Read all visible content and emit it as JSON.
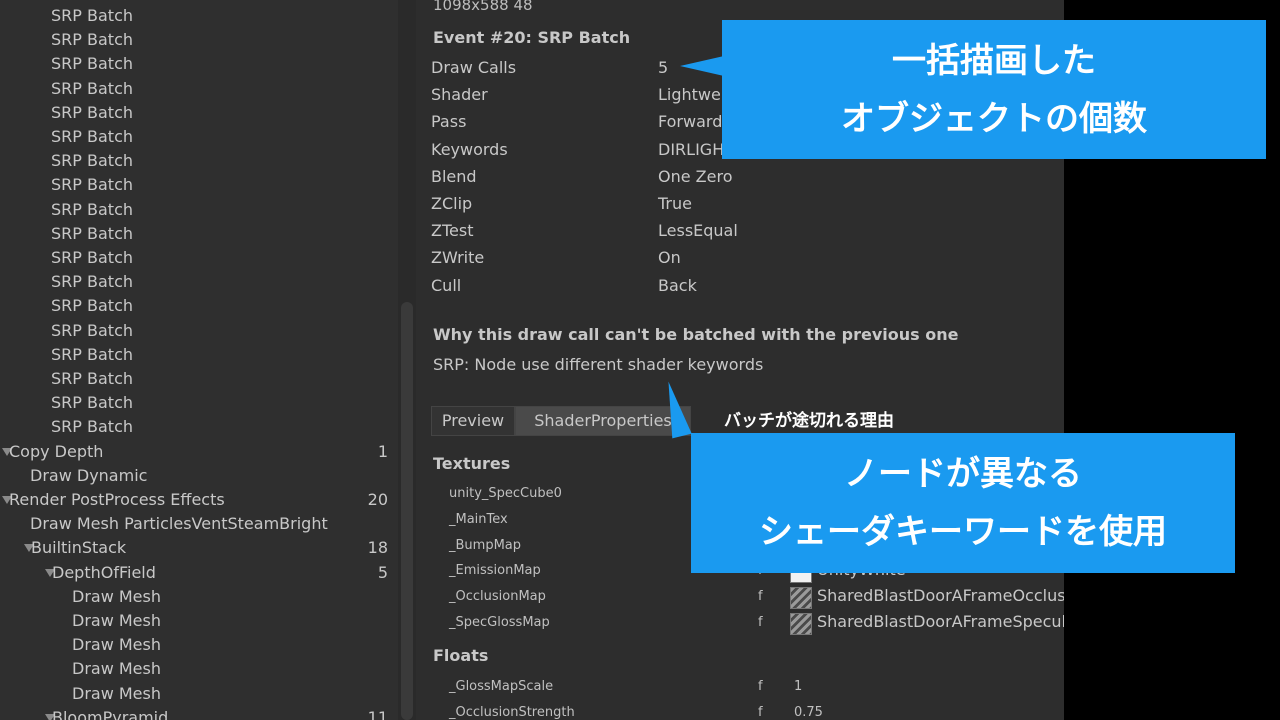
{
  "hierarchy": {
    "rows": [
      {
        "label": "SRP Batch",
        "count": "",
        "depth": 2,
        "expander": "none"
      },
      {
        "label": "SRP Batch",
        "count": "",
        "depth": 2,
        "expander": "none"
      },
      {
        "label": "SRP Batch",
        "count": "",
        "depth": 2,
        "expander": "none"
      },
      {
        "label": "SRP Batch",
        "count": "",
        "depth": 2,
        "expander": "none"
      },
      {
        "label": "SRP Batch",
        "count": "",
        "depth": 2,
        "expander": "none"
      },
      {
        "label": "SRP Batch",
        "count": "",
        "depth": 2,
        "expander": "none"
      },
      {
        "label": "SRP Batch",
        "count": "",
        "depth": 2,
        "expander": "none"
      },
      {
        "label": "SRP Batch",
        "count": "",
        "depth": 2,
        "expander": "none"
      },
      {
        "label": "SRP Batch",
        "count": "",
        "depth": 2,
        "expander": "none"
      },
      {
        "label": "SRP Batch",
        "count": "",
        "depth": 2,
        "expander": "none"
      },
      {
        "label": "SRP Batch",
        "count": "",
        "depth": 2,
        "expander": "none"
      },
      {
        "label": "SRP Batch",
        "count": "",
        "depth": 2,
        "expander": "none"
      },
      {
        "label": "SRP Batch",
        "count": "",
        "depth": 2,
        "expander": "none"
      },
      {
        "label": "SRP Batch",
        "count": "",
        "depth": 2,
        "expander": "none"
      },
      {
        "label": "SRP Batch",
        "count": "",
        "depth": 2,
        "expander": "none"
      },
      {
        "label": "SRP Batch",
        "count": "",
        "depth": 2,
        "expander": "none"
      },
      {
        "label": "SRP Batch",
        "count": "",
        "depth": 2,
        "expander": "none"
      },
      {
        "label": "SRP Batch",
        "count": "",
        "depth": 2,
        "expander": "none"
      },
      {
        "label": "Copy Depth",
        "count": "1",
        "depth": 0,
        "expander": "open"
      },
      {
        "label": "Draw Dynamic",
        "count": "",
        "depth": 1,
        "expander": "none"
      },
      {
        "label": "Render PostProcess Effects",
        "count": "20",
        "depth": 0,
        "expander": "open"
      },
      {
        "label": "Draw Mesh ParticlesVentSteamBright",
        "count": "",
        "depth": 1,
        "expander": "none"
      },
      {
        "label": "BuiltinStack",
        "count": "18",
        "depth": 1,
        "expander": "open"
      },
      {
        "label": "DepthOfField",
        "count": "5",
        "depth": 2,
        "expander": "open"
      },
      {
        "label": "Draw Mesh",
        "count": "",
        "depth": 3,
        "expander": "none"
      },
      {
        "label": "Draw Mesh",
        "count": "",
        "depth": 3,
        "expander": "none"
      },
      {
        "label": "Draw Mesh",
        "count": "",
        "depth": 3,
        "expander": "none"
      },
      {
        "label": "Draw Mesh",
        "count": "",
        "depth": 3,
        "expander": "none"
      },
      {
        "label": "Draw Mesh",
        "count": "",
        "depth": 3,
        "expander": "none"
      },
      {
        "label": "BloomPyramid",
        "count": "11",
        "depth": 2,
        "expander": "open"
      }
    ]
  },
  "details": {
    "resolution": "1098x588 48",
    "event_title": "Event #20: SRP Batch",
    "props": [
      {
        "name": "Draw Calls",
        "value": "5"
      },
      {
        "name": "Shader",
        "value": "Lightwe"
      },
      {
        "name": "Pass",
        "value": "Forward"
      },
      {
        "name": "Keywords",
        "value": "DIRLIGH"
      },
      {
        "name": "Blend",
        "value": "One Zero"
      },
      {
        "name": "ZClip",
        "value": "True"
      },
      {
        "name": "ZTest",
        "value": "LessEqual"
      },
      {
        "name": "ZWrite",
        "value": "On"
      },
      {
        "name": "Cull",
        "value": "Back"
      }
    ],
    "why_title": "Why this draw call can't be batched with the previous one",
    "why_reason": "SRP: Node use different shader keywords",
    "tabs": [
      "Preview",
      "ShaderProperties"
    ],
    "textures_heading": "Textures",
    "textures": [
      {
        "name": "unity_SpecCube0",
        "flag": "",
        "value": "",
        "thumb": "none"
      },
      {
        "name": "_MainTex",
        "flag": "",
        "value": "",
        "thumb": "none"
      },
      {
        "name": "_BumpMap",
        "flag": "",
        "value": "",
        "thumb": "none"
      },
      {
        "name": "_EmissionMap",
        "flag": "f",
        "value": "UnityWhite",
        "thumb": "white"
      },
      {
        "name": "_OcclusionMap",
        "flag": "f",
        "value": "SharedBlastDoorAFrameOcclus",
        "thumb": "occlusion"
      },
      {
        "name": "_SpecGlossMap",
        "flag": "f",
        "value": "SharedBlastDoorAFrameSpecul",
        "thumb": "specular"
      }
    ],
    "floats_heading": "Floats",
    "floats": [
      {
        "name": "_GlossMapScale",
        "flag": "f",
        "value": "1"
      },
      {
        "name": "_OcclusionStrength",
        "flag": "f",
        "value": "0.75"
      }
    ]
  },
  "annotations": {
    "callout_top": [
      "一括描画した",
      "オブジェクトの個数"
    ],
    "small_note": "バッチが途切れる理由",
    "callout_bottom": [
      "ノードが異なる",
      "シェーダキーワードを使用"
    ]
  }
}
